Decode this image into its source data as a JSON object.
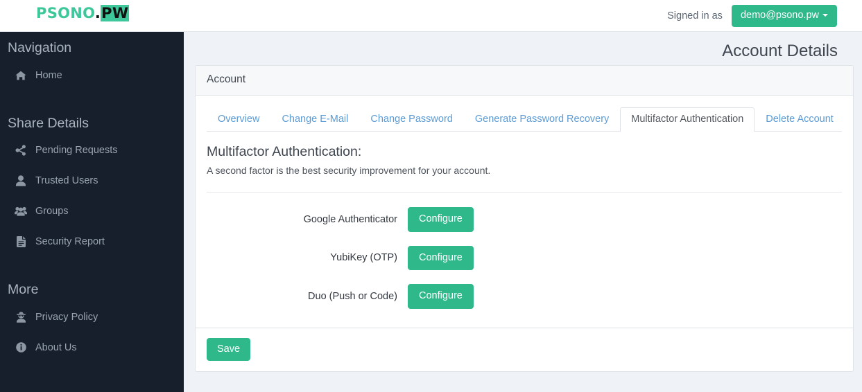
{
  "brand": {
    "name": "PSONO",
    "dot": ".",
    "suffix": "PW"
  },
  "topbar": {
    "signed_in_label": "Signed in as",
    "user_email": "demo@psono.pw",
    "accent_color": "#2fb98a"
  },
  "sidebar": {
    "sections": [
      {
        "heading": "Navigation",
        "items": [
          {
            "label": "Home",
            "icon": "home-icon"
          }
        ]
      },
      {
        "heading": "Share Details",
        "items": [
          {
            "label": "Pending Requests",
            "icon": "share-icon"
          },
          {
            "label": "Trusted Users",
            "icon": "user-icon"
          },
          {
            "label": "Groups",
            "icon": "users-icon"
          },
          {
            "label": "Security Report",
            "icon": "file-text-icon"
          }
        ]
      },
      {
        "heading": "More",
        "items": [
          {
            "label": "Privacy Policy",
            "icon": "user-secret-icon"
          },
          {
            "label": "About Us",
            "icon": "info-circle-icon"
          }
        ]
      }
    ]
  },
  "main": {
    "page_title": "Account Details",
    "card_header": "Account",
    "tabs": [
      {
        "label": "Overview",
        "active": false
      },
      {
        "label": "Change E-Mail",
        "active": false
      },
      {
        "label": "Change Password",
        "active": false
      },
      {
        "label": "Generate Password Recovery",
        "active": false
      },
      {
        "label": "Multifactor Authentication",
        "active": true
      },
      {
        "label": "Delete Account",
        "active": false
      }
    ],
    "panel": {
      "title": "Multifactor Authentication:",
      "description": "A second factor is the best security improvement for your account.",
      "rows": [
        {
          "label": "Google Authenticator",
          "button": "Configure"
        },
        {
          "label": "YubiKey (OTP)",
          "button": "Configure"
        },
        {
          "label": "Duo (Push or Code)",
          "button": "Configure"
        }
      ]
    },
    "footer": {
      "save_label": "Save"
    }
  }
}
